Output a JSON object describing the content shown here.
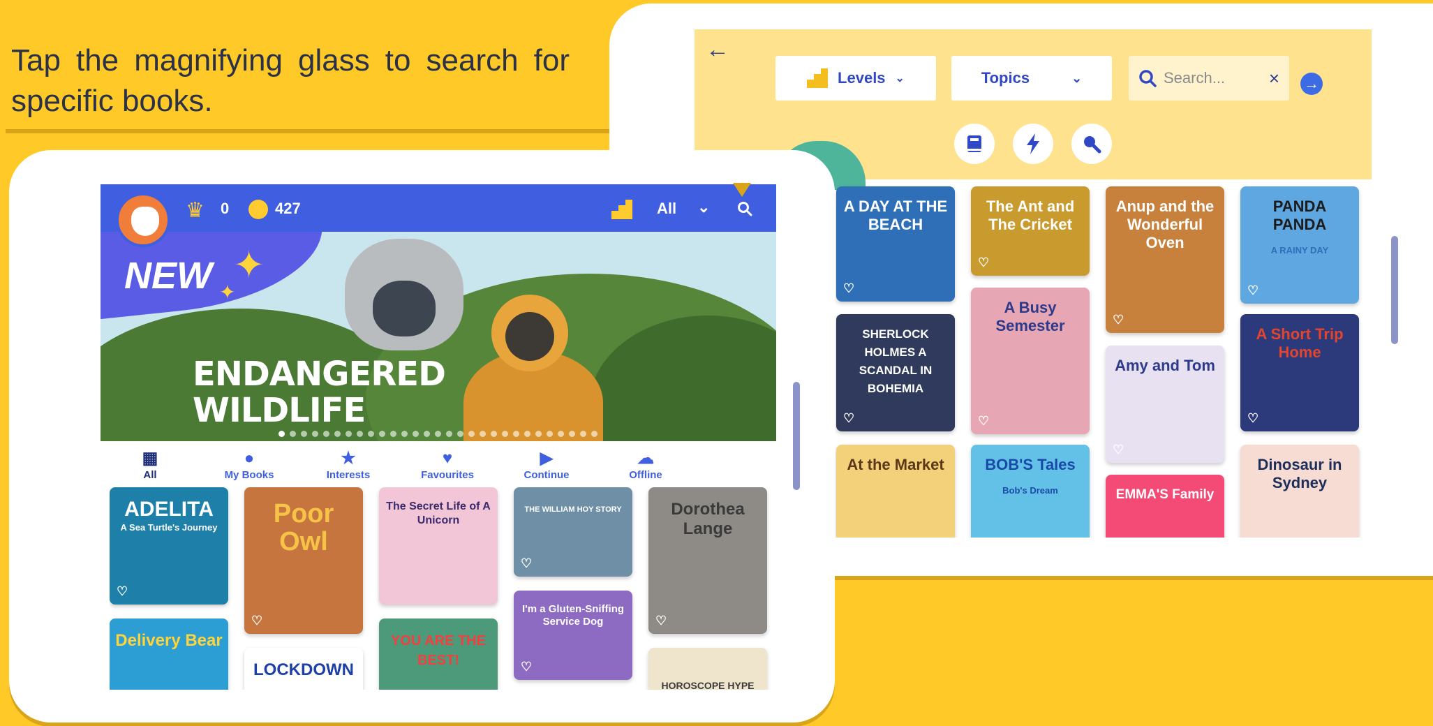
{
  "instruction": "Tap the magnifying glass to search for specific books.",
  "left_app": {
    "header": {
      "crowns": "0",
      "coins": "427",
      "level_label": "All",
      "dropdown_icon": "chevron-down-icon",
      "search_icon": "search-icon"
    },
    "banner": {
      "badge": "NEW",
      "title_line1": "ENDANGERED",
      "title_line2": "WILDLIFE",
      "slide_count": 29,
      "active_slide": 1
    },
    "tabs": [
      {
        "label": "All",
        "icon": "grid-icon"
      },
      {
        "label": "My Books",
        "icon": "person-icon"
      },
      {
        "label": "Interests",
        "icon": "star-icon"
      },
      {
        "label": "Favourites",
        "icon": "heart-icon"
      },
      {
        "label": "Continue",
        "icon": "play-icon"
      },
      {
        "label": "Offline",
        "icon": "cloud-icon"
      }
    ],
    "books": [
      {
        "title": "ADELITA",
        "subtitle": "A Sea Turtle's Journey",
        "color": "#1E7FA8"
      },
      {
        "title": "Poor Owl",
        "subtitle": "",
        "color": "#C6753F"
      },
      {
        "title": "The Secret Life of A Unicorn",
        "subtitle": "",
        "color": "#F2C6D6"
      },
      {
        "title": "THE WILLIAM HOY STORY",
        "subtitle": "",
        "color": "#6E8FA6"
      },
      {
        "title": "Dorothea Lange",
        "subtitle": "",
        "color": "#8E8A86"
      },
      {
        "title": "Delivery Bear",
        "subtitle": "",
        "color": "#2D9ED3"
      },
      {
        "title": "LOCKDOWN",
        "subtitle": "",
        "color": "#FFFFFF"
      },
      {
        "title": "YOU ARE THE BEST!",
        "subtitle": "",
        "color": "#4D9A7A"
      },
      {
        "title": "I'm a Gluten-Sniffing Service Dog",
        "subtitle": "",
        "color": "#8E6BC2"
      },
      {
        "title": "HOROSCOPE HYPE",
        "subtitle": "",
        "color": "#EFE4CC"
      }
    ]
  },
  "right_app": {
    "back_icon": "arrow-left-icon",
    "filters": {
      "levels": "Levels",
      "topics": "Topics",
      "search_placeholder": "Search...",
      "clear_icon": "close-icon",
      "go_icon": "arrow-right-icon"
    },
    "mode_icons": [
      "book-icon",
      "lightning-icon",
      "search-icon"
    ],
    "books": [
      {
        "title": "A DAY AT THE BEACH",
        "color": "#2E6FB8"
      },
      {
        "title": "The Ant and The Cricket",
        "color": "#C99A2E"
      },
      {
        "title": "Anup and the Wonderful Oven",
        "color": "#C7813C"
      },
      {
        "title": "PANDA PANDA",
        "subtitle": "A RAINY DAY",
        "color": "#5FA7E0"
      },
      {
        "title": "SHERLOCK HOLMES A SCANDAL IN BOHEMIA",
        "color": "#2F3A5C"
      },
      {
        "title": "A Busy Semester",
        "color": "#E7A6B3"
      },
      {
        "title": "Amy and Tom",
        "color": "#E7E1F2"
      },
      {
        "title": "A Short Trip Home",
        "color": "#2C3A7C"
      },
      {
        "title": "At the Market",
        "color": "#F3D07A"
      },
      {
        "title": "BOB'S Tales",
        "subtitle": "Bob's Dream",
        "color": "#63C1E8"
      },
      {
        "title": "EMMA'S Family",
        "color": "#F34B76"
      },
      {
        "title": "Dinosaur in Sydney",
        "color": "#F6DCD2"
      }
    ]
  }
}
